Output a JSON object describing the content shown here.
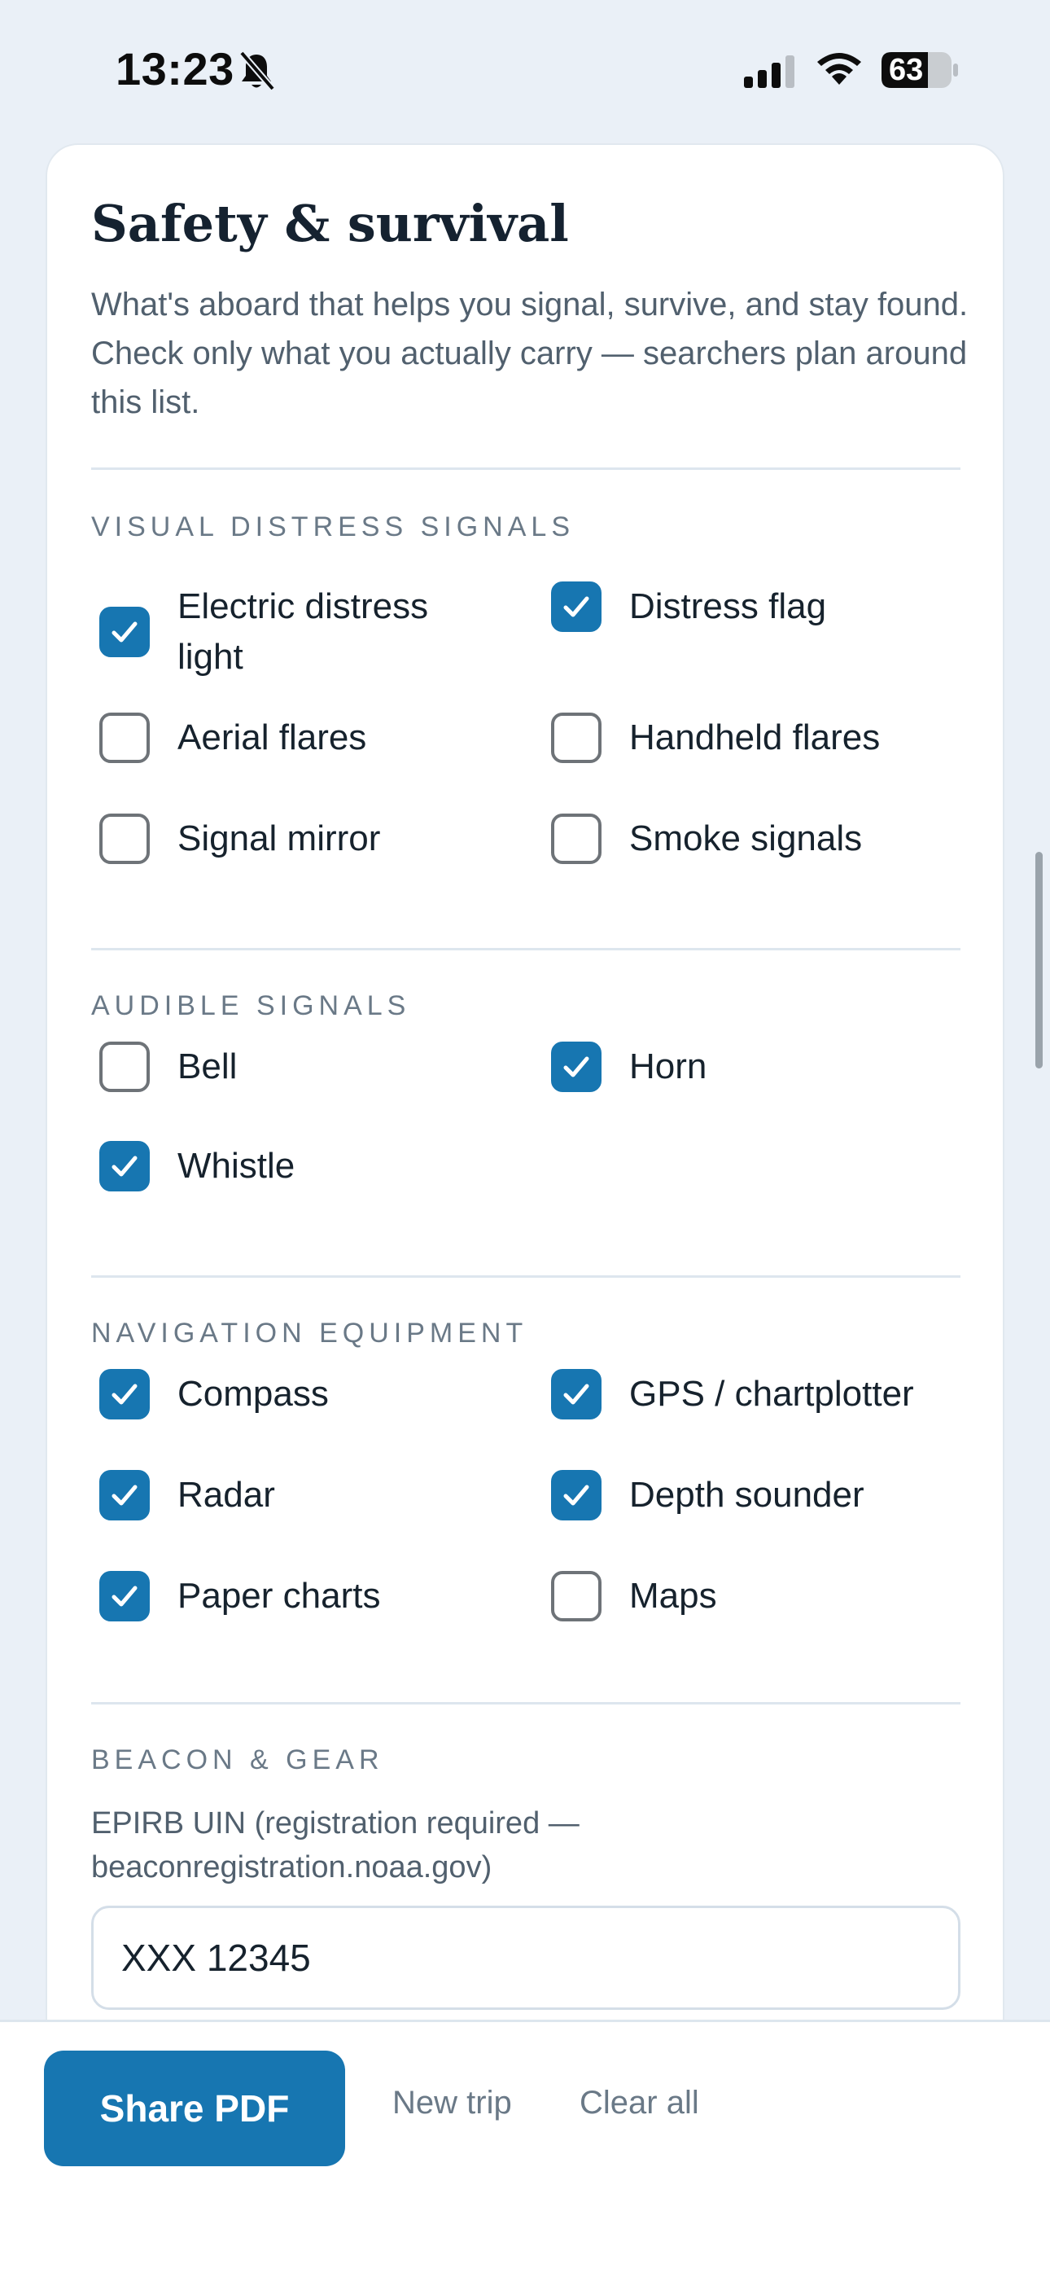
{
  "status": {
    "time": "13:23",
    "battery": "63"
  },
  "section": {
    "title": "Safety & survival",
    "description": "What's aboard that helps you signal, survive, and stay found. Check only what you actually carry — searchers plan around this list."
  },
  "groups": {
    "visual": {
      "label": "VISUAL DISTRESS SIGNALS",
      "items": [
        {
          "label": "Electric distress light",
          "checked": true
        },
        {
          "label": "Distress flag",
          "checked": true
        },
        {
          "label": "Aerial flares",
          "checked": false
        },
        {
          "label": "Handheld flares",
          "checked": false
        },
        {
          "label": "Signal mirror",
          "checked": false
        },
        {
          "label": "Smoke signals",
          "checked": false
        }
      ]
    },
    "audible": {
      "label": "AUDIBLE SIGNALS",
      "items": [
        {
          "label": "Bell",
          "checked": false
        },
        {
          "label": "Horn",
          "checked": true
        },
        {
          "label": "Whistle",
          "checked": true
        }
      ]
    },
    "navigation": {
      "label": "NAVIGATION EQUIPMENT",
      "items": [
        {
          "label": "Compass",
          "checked": true
        },
        {
          "label": "GPS / chartplotter",
          "checked": true
        },
        {
          "label": "Radar",
          "checked": true
        },
        {
          "label": "Depth sounder",
          "checked": true
        },
        {
          "label": "Paper charts",
          "checked": true
        },
        {
          "label": "Maps",
          "checked": false
        }
      ]
    },
    "beacon": {
      "label": "BEACON & GEAR",
      "field_label": "EPIRB UIN (registration required — beaconregistration.noaa.gov)",
      "field_value": "XXX 12345"
    }
  },
  "actions": {
    "share": "Share PDF",
    "new_trip": "New trip",
    "clear_all": "Clear all"
  },
  "colors": {
    "accent": "#1776b1",
    "background": "#eaf0f7"
  }
}
